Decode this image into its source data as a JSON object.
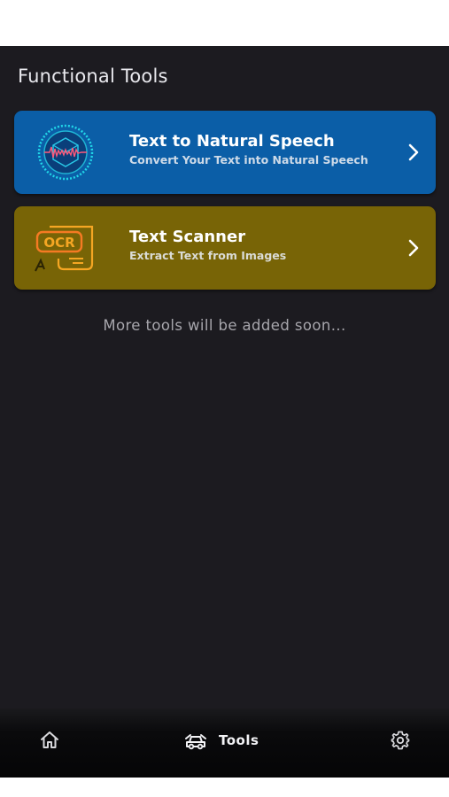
{
  "header": {
    "title": "Functional Tools"
  },
  "tools": [
    {
      "title": "Text to Natural Speech",
      "subtitle": "Convert Your Text into Natural Speech",
      "icon": "speech-waveform-icon",
      "color": "#0b5ea7"
    },
    {
      "title": "Text Scanner",
      "subtitle": "Extract Text from Images",
      "icon": "ocr-document-icon",
      "icon_text": "OCR",
      "color": "#786406"
    }
  ],
  "footer_note": "More tools will be added soon...",
  "bottom_nav": {
    "home_icon": "home-icon",
    "tools_label": "Tools",
    "tools_icon": "tools-icon",
    "settings_icon": "gear-icon",
    "active": "Tools"
  }
}
